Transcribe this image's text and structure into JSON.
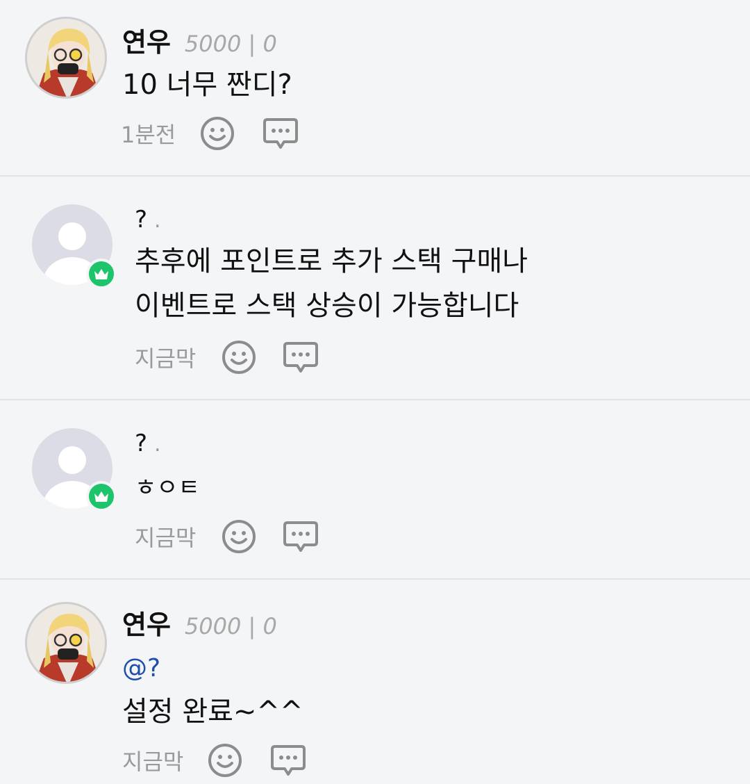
{
  "colors": {
    "background": "#f4f5f7",
    "divider": "#e2e3e6",
    "badge": "#1ec46b",
    "mention": "#1f4fa8",
    "muted": "#9a9a9a"
  },
  "comments": [
    {
      "name": "연우",
      "points": "5000 | 0",
      "text": "10 너무 짠디?",
      "time": "1분전",
      "avatar": "photo"
    },
    {
      "name": "?",
      "dot": ".",
      "text_line1": "추후에 포인트로 추가 스택 구매나",
      "text_line2": "이벤트로 스택 상승이 가능합니다",
      "time": "지금막",
      "avatar": "default",
      "badge": "crown-icon"
    },
    {
      "name": "?",
      "dot": ".",
      "text": "ㅎㅇㅌ",
      "time": "지금막",
      "avatar": "default",
      "badge": "crown-icon"
    },
    {
      "name": "연우",
      "points": "5000 | 0",
      "mention": "@?",
      "text": "설정 완료~^^",
      "time": "지금막",
      "avatar": "photo"
    }
  ],
  "icons": {
    "reaction": "smiley-icon",
    "reply": "speech-bubble-icon",
    "badge": "crown-icon"
  }
}
